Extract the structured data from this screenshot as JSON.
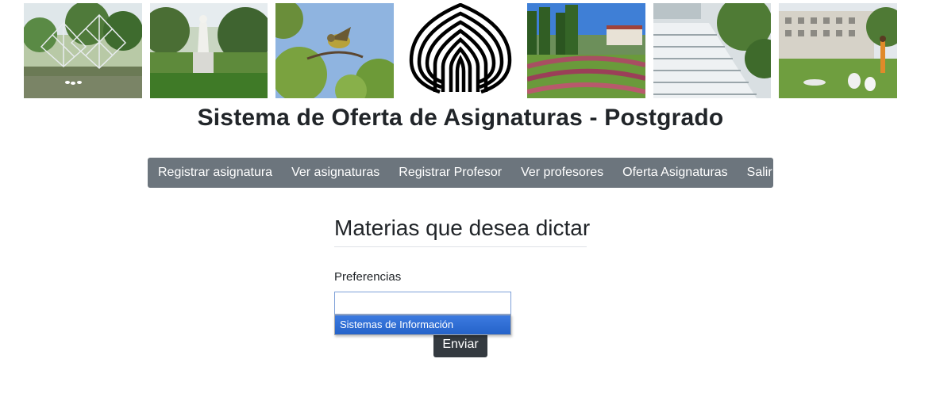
{
  "banner": {
    "images": [
      {
        "name": "sculpture-lake-photo"
      },
      {
        "name": "statue-garden-photo"
      },
      {
        "name": "bird-photo"
      },
      {
        "name": "usb-logo"
      },
      {
        "name": "campus-garden-photo"
      },
      {
        "name": "waterfall-photo"
      },
      {
        "name": "building-lawn-photo"
      }
    ]
  },
  "page": {
    "title": "Sistema de Oferta de Asignaturas - Postgrado"
  },
  "nav": {
    "items": [
      {
        "label": "Registrar asignatura"
      },
      {
        "label": "Ver asignaturas"
      },
      {
        "label": "Registrar Profesor"
      },
      {
        "label": "Ver profesores"
      },
      {
        "label": "Oferta Asignaturas"
      },
      {
        "label": "Salir"
      }
    ],
    "color": "#6c757d"
  },
  "form": {
    "heading": "Materias que desea dictar",
    "preferences_label": "Preferencias",
    "preferences_value": "",
    "options": [
      {
        "label": "Sistemas de Información",
        "highlighted": true
      }
    ],
    "submit_label": "Enviar",
    "submit_color": "#343a40",
    "highlight_color": "#2f6fd0"
  }
}
